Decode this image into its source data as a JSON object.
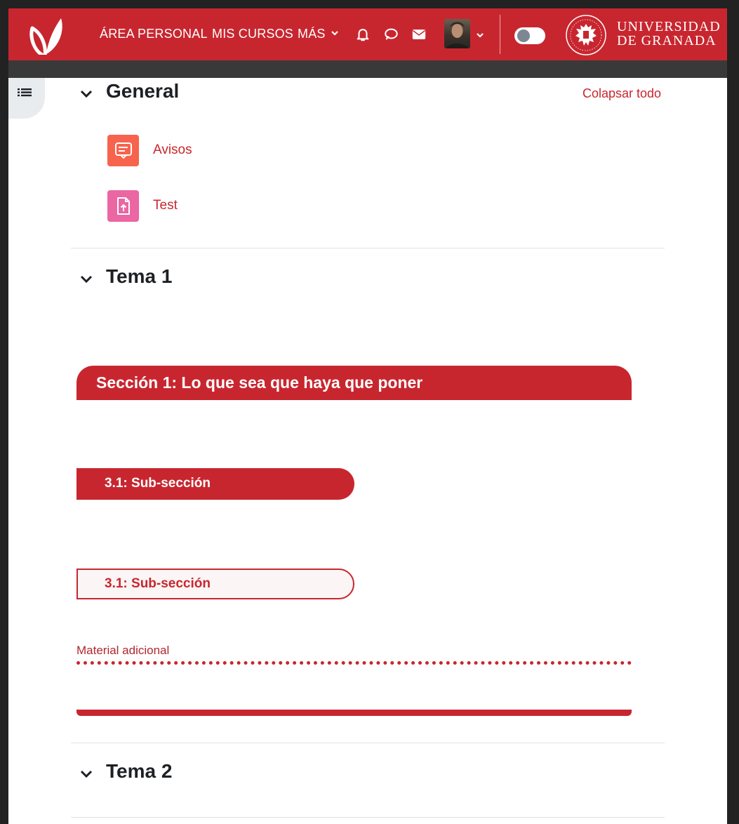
{
  "nav": {
    "items": [
      "ÁREA PERSONAL",
      "MIS CURSOS",
      "MÁS"
    ],
    "icons": [
      "bell-icon",
      "chat-bubble-icon",
      "envelope-icon"
    ],
    "brand_color": "#c8262f",
    "university_line1": "UNIVERSIDAD",
    "university_line2": "DE GRANADA"
  },
  "course": {
    "collapse_all": "Colapsar todo",
    "sections": [
      {
        "title": "General"
      },
      {
        "title": "Tema 1"
      },
      {
        "title": "Tema 2"
      }
    ],
    "activities": [
      {
        "label": "Avisos",
        "icon": "forum-icon",
        "color": "#f7634d"
      },
      {
        "label": "Test",
        "icon": "assignment-icon",
        "color": "#eb66a2"
      }
    ],
    "tema1": {
      "banner": "Sección 1: Lo que sea que haya que poner",
      "subsection_filled": "3.1: Sub-sección",
      "subsection_outline": "3.1: Sub-sección",
      "extra_material": "Material adicional"
    }
  }
}
